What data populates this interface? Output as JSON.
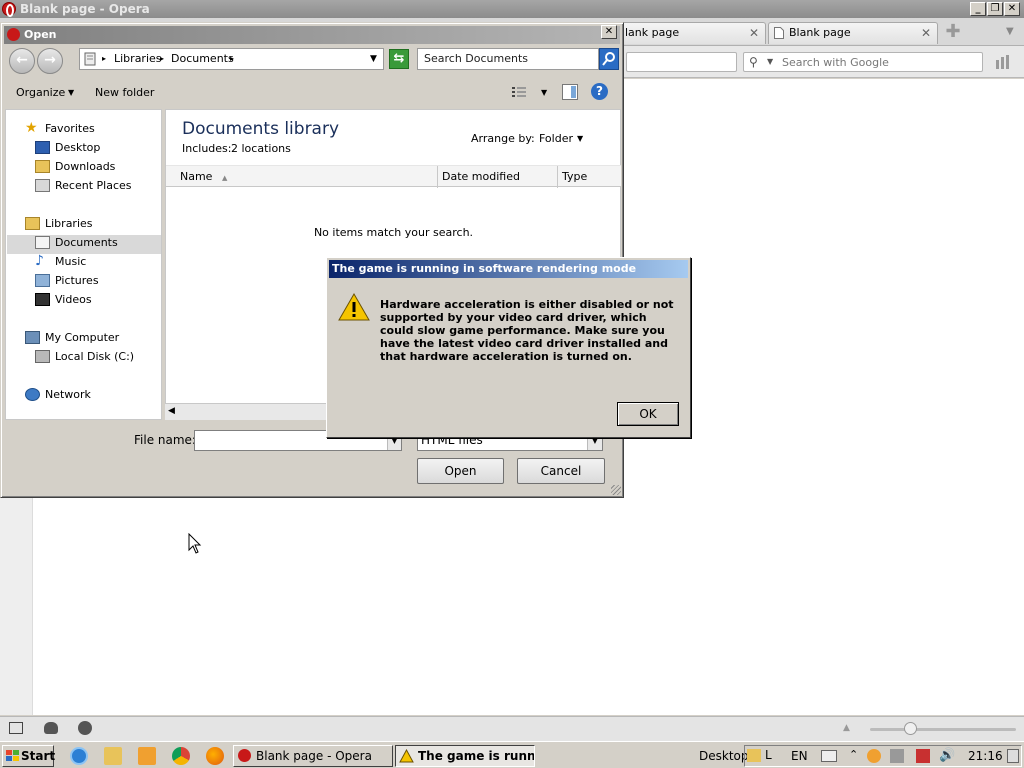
{
  "opera": {
    "window_title": "Blank page - Opera",
    "tabs": [
      {
        "label": "lank page"
      },
      {
        "label": "Blank page"
      }
    ],
    "google_search_placeholder": "Search with Google",
    "controls": {
      "minimize": "_",
      "restore": "❐",
      "close": "✕"
    }
  },
  "open_dialog": {
    "title": "Open",
    "breadcrumb": [
      "Libraries",
      "Documents"
    ],
    "search_placeholder": "Search Documents",
    "toolbar": {
      "organize": "Organize",
      "new_folder": "New folder"
    },
    "nav": {
      "favorites": "Favorites",
      "favorites_items": [
        "Desktop",
        "Downloads",
        "Recent Places"
      ],
      "libraries": "Libraries",
      "libraries_items": [
        "Documents",
        "Music",
        "Pictures",
        "Videos"
      ],
      "computer": "My Computer",
      "computer_items": [
        "Local Disk (C:)"
      ],
      "network": "Network",
      "selected": "Documents"
    },
    "library_title": "Documents library",
    "includes_label": "Includes:",
    "includes_link": "2 locations",
    "arrange_by_label": "Arrange by:",
    "arrange_by_value": "Folder",
    "columns": [
      "Name",
      "Date modified",
      "Type"
    ],
    "empty_message": "No items match your search.",
    "file_name_label": "File name:",
    "file_name_value": "",
    "file_type_value": "HTML files",
    "open_button": "Open",
    "cancel_button": "Cancel"
  },
  "message_box": {
    "title": "The game is running in software rendering mode",
    "text": "Hardware acceleration is either disabled or not supported by your video card driver, which could slow game performance. Make sure you have the latest video card driver installed and that hardware acceleration is turned on.",
    "ok_button": "OK"
  },
  "taskbar": {
    "start": "Start",
    "tasks": [
      "Blank page - Opera",
      "The game is runni..."
    ],
    "desktop_label": "Desktop",
    "language": "EN",
    "clock": "21:16"
  },
  "colors": {
    "msgbox_title_start": "#0a246a",
    "msgbox_title_end": "#a6caf0",
    "opera_red": "#c81818",
    "warning_yellow": "#f5c400"
  }
}
